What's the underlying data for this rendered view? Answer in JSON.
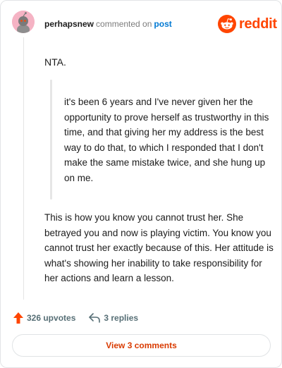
{
  "comment": {
    "author": "perhapsnew",
    "action_text": "commented on",
    "target_text": "post",
    "paragraph_1": "NTA.",
    "quote": "it's been 6 years and I've never given her the opportunity to prove herself as trustworthy in this time, and that giving her my address is the best way to do that, to which I responded that I don't make the same mistake twice, and she hung up on me.",
    "paragraph_2": "This is how you know you cannot trust her. She betrayed you and now is playing victim. You know you cannot trust her exactly because of this. Her attitude is what's showing her inability to take responsibility for her actions and learn a lesson."
  },
  "brand": {
    "wordmark": "reddit",
    "color": "#ff4500"
  },
  "footer": {
    "upvotes_label": "326 upvotes",
    "replies_label": "3 replies",
    "view_comments_label": "View 3 comments"
  },
  "colors": {
    "accent": "#d93a00",
    "upvote": "#ff4500",
    "link": "#0079d3",
    "avatar_bg": "#f5b3c4"
  },
  "icons": [
    "snoo-avatar-icon",
    "reddit-logo-icon",
    "upvote-arrow-icon",
    "reply-arrow-icon"
  ]
}
